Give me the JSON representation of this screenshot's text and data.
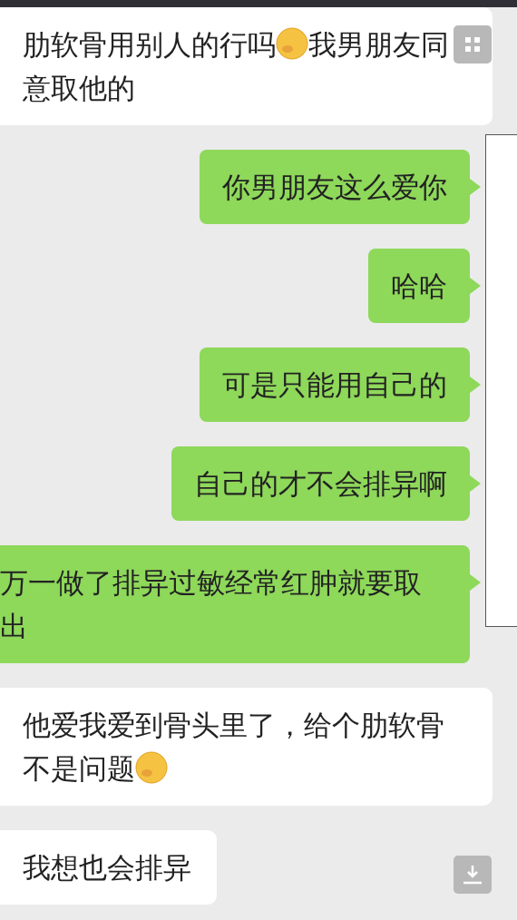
{
  "messages": [
    {
      "kind": "received",
      "parts": [
        {
          "kind": "text",
          "text": "肋软骨用别人的行吗"
        },
        {
          "kind": "emoji"
        },
        {
          "kind": "text",
          "text": "我男朋友同意取他的"
        }
      ]
    },
    {
      "kind": "sent",
      "parts": [
        {
          "kind": "text",
          "text": "你男朋友这么爱你"
        }
      ]
    },
    {
      "kind": "sent",
      "parts": [
        {
          "kind": "text",
          "text": "哈哈"
        }
      ]
    },
    {
      "kind": "sent",
      "parts": [
        {
          "kind": "text",
          "text": "可是只能用自己的"
        }
      ]
    },
    {
      "kind": "sent",
      "parts": [
        {
          "kind": "text",
          "text": "自己的才不会排异啊"
        }
      ]
    },
    {
      "kind": "sent",
      "parts": [
        {
          "kind": "text",
          "text": "万一做了排异过敏经常红肿就要取出"
        }
      ]
    },
    {
      "kind": "received",
      "parts": [
        {
          "kind": "text",
          "text": "他爱我爱到骨头里了，给个肋软骨不是问题"
        },
        {
          "kind": "emoji"
        }
      ]
    },
    {
      "kind": "received",
      "parts": [
        {
          "kind": "text",
          "text": "我想也会排异"
        }
      ]
    }
  ]
}
